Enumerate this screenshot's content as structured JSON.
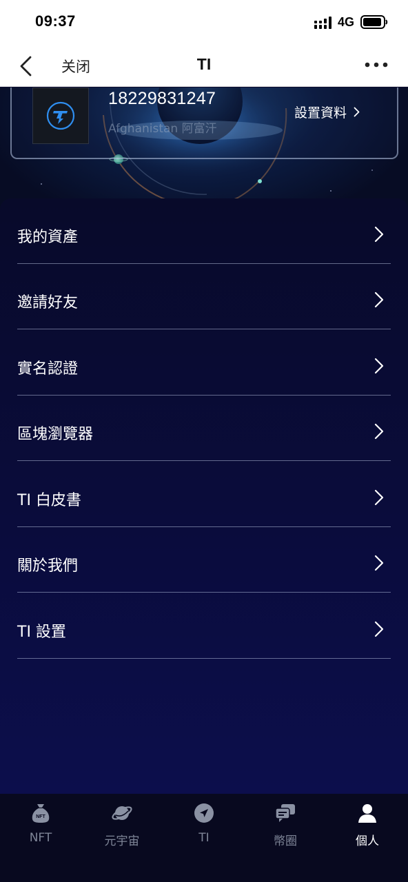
{
  "status_bar": {
    "time": "09:37",
    "network": "4G",
    "icons": [
      "signal-icon",
      "battery-icon"
    ]
  },
  "nav": {
    "close_label": "关闭",
    "title": "TI",
    "icons": [
      "back-icon",
      "more-icon"
    ]
  },
  "profile": {
    "phone": "18229831247",
    "region": "Afghanistan 阿富汗",
    "settings_label": "設置資料",
    "avatar_icon": "ti-logo-icon"
  },
  "menu": {
    "items": [
      {
        "label": "我的資產"
      },
      {
        "label": "邀請好友"
      },
      {
        "label": "實名認證"
      },
      {
        "label": "區塊瀏覽器"
      },
      {
        "label": "TI 白皮書"
      },
      {
        "label": "關於我們"
      },
      {
        "label": "TI 設置"
      }
    ]
  },
  "tabs": {
    "items": [
      {
        "label": "NFT",
        "icon": "money-bag-icon",
        "badge": "NFT"
      },
      {
        "label": "元宇宙",
        "icon": "planet-icon"
      },
      {
        "label": "TI",
        "icon": "navigation-icon"
      },
      {
        "label": "幣圈",
        "icon": "chat-bubbles-icon"
      },
      {
        "label": "個人",
        "icon": "person-icon"
      }
    ],
    "active_index": 4
  },
  "colors": {
    "panel": "#0a0c3c",
    "tab_bar": "#08091f",
    "tab_inactive": "#7e8597",
    "tab_active": "#ffffff",
    "divider": "#afb9d7"
  }
}
